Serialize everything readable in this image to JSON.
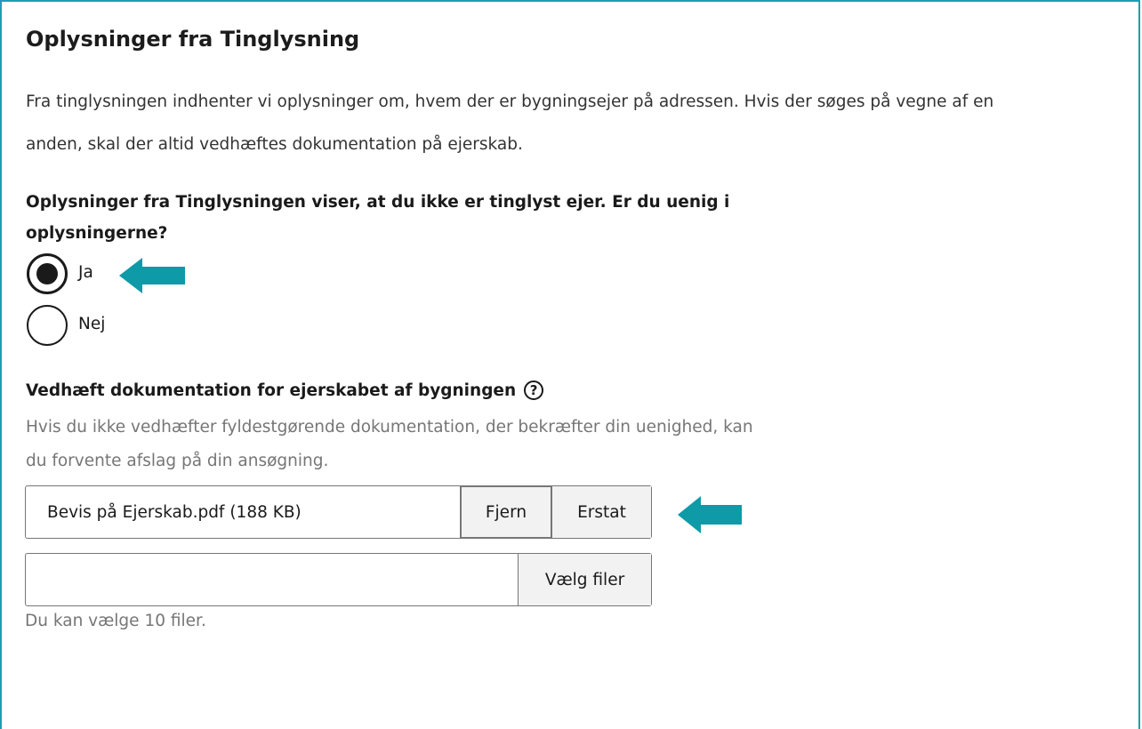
{
  "section": {
    "title": "Oplysninger fra Tinglysning",
    "intro_line1": "Fra tinglysningen indhenter vi oplysninger om, hvem der er bygningsejer på adressen. Hvis der søges på vegne af en",
    "intro_line2": "anden, skal der altid vedhæftes dokumentation på ejerskab."
  },
  "question": {
    "line1": "Oplysninger fra Tinglysningen viser, at du ikke er tinglyst ejer. Er du uenig i",
    "line2": "oplysningerne?",
    "options": [
      {
        "label": "Ja",
        "selected": true
      },
      {
        "label": "Nej",
        "selected": false
      }
    ]
  },
  "attachment": {
    "label": "Vedhæft dokumentation for ejerskabet af bygningen",
    "help_icon": "question-circle-icon",
    "desc_line1": "Hvis du ikke vedhæfter fyldestgørende dokumentation, der bekræfter din uenighed, kan",
    "desc_line2": "du forvente afslag på din ansøgning.",
    "file": {
      "name": "Bevis på Ejerskab.pdf (188 KB)",
      "remove_label": "Fjern",
      "replace_label": "Erstat"
    },
    "choose_label": "Vælg filer",
    "hint": "Du kan vælge 10 filer."
  },
  "colors": {
    "accent": "#1a9fb5",
    "arrow": "#0e9aa7",
    "muted_text": "#767676"
  },
  "icons": {
    "annotation_arrow": "arrow-left-icon"
  }
}
